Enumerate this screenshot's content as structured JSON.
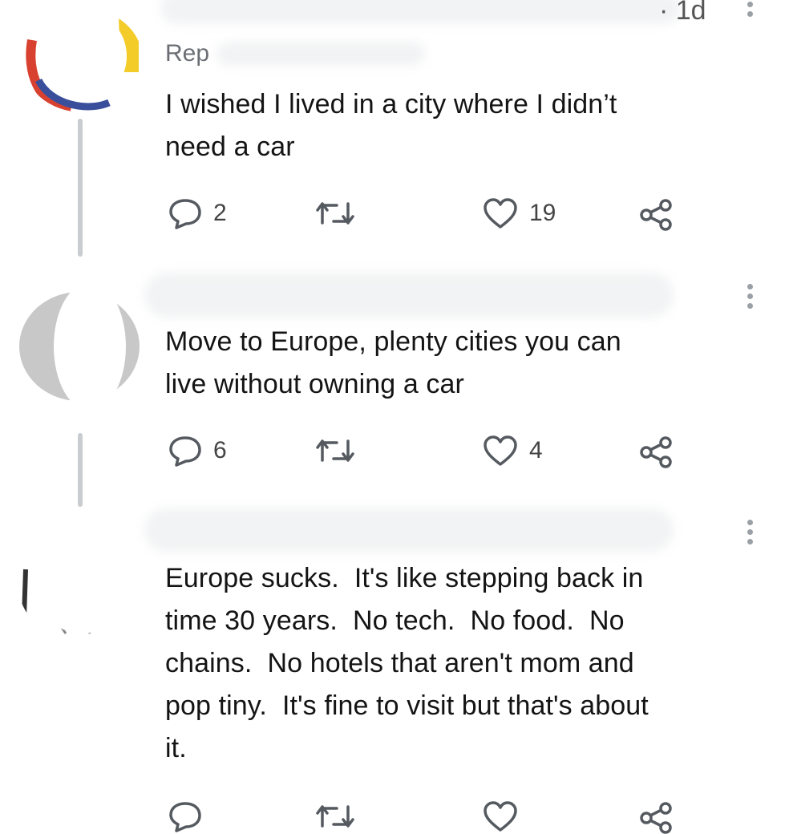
{
  "tweets": [
    {
      "header_fragment": "Rep",
      "time": "· 1d",
      "text": "I wished I lived in a city where I didn’t\nneed a car",
      "replies": "2",
      "retweets": "",
      "likes": "19"
    },
    {
      "header_fragment": "",
      "time": "",
      "text": "Move to Europe, plenty cities you can\nlive without owning a car",
      "replies": "6",
      "retweets": "",
      "likes": "4"
    },
    {
      "header_fragment": "",
      "time": "",
      "text": "Europe sucks.  It's like stepping back in\ntime 30 years.  No tech.  No food.  No\nchains.  No hotels that aren't mom and\npop tiny.  It's fine to visit but that's about\nit.",
      "replies": "",
      "retweets": "",
      "likes": ""
    }
  ],
  "icons": {
    "reply": "speech-bubble",
    "retweet": "retweet-arrows",
    "like": "heart",
    "share": "share-nodes",
    "more": "vertical-dots"
  },
  "colors": {
    "icon": "#555a60",
    "thread_line": "#c9ccd0",
    "text": "#141414"
  }
}
